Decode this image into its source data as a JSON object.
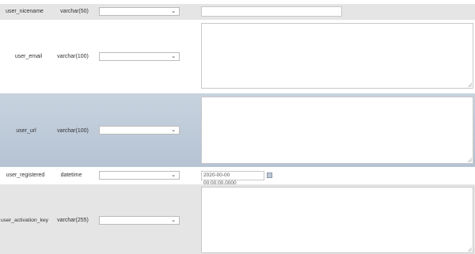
{
  "columns": [
    {
      "name": "user_nicename",
      "type": "varchar(50)",
      "function_value": "",
      "value": ""
    },
    {
      "name": "user_email",
      "type": "varchar(100)",
      "function_value": "",
      "value": ""
    },
    {
      "name": "user_url",
      "type": "varchar(100)",
      "function_value": "",
      "value": ""
    },
    {
      "name": "user_registered",
      "type": "datetime",
      "function_value": "",
      "value": "2020-00-00 00:00:00.0000"
    },
    {
      "name": "user_activation_key",
      "type": "varchar(255)",
      "function_value": "",
      "value": ""
    }
  ],
  "icons": {
    "dropdown": "chevron-down-icon",
    "calendar": "calendar-icon",
    "resize": "resize-grip-icon"
  }
}
